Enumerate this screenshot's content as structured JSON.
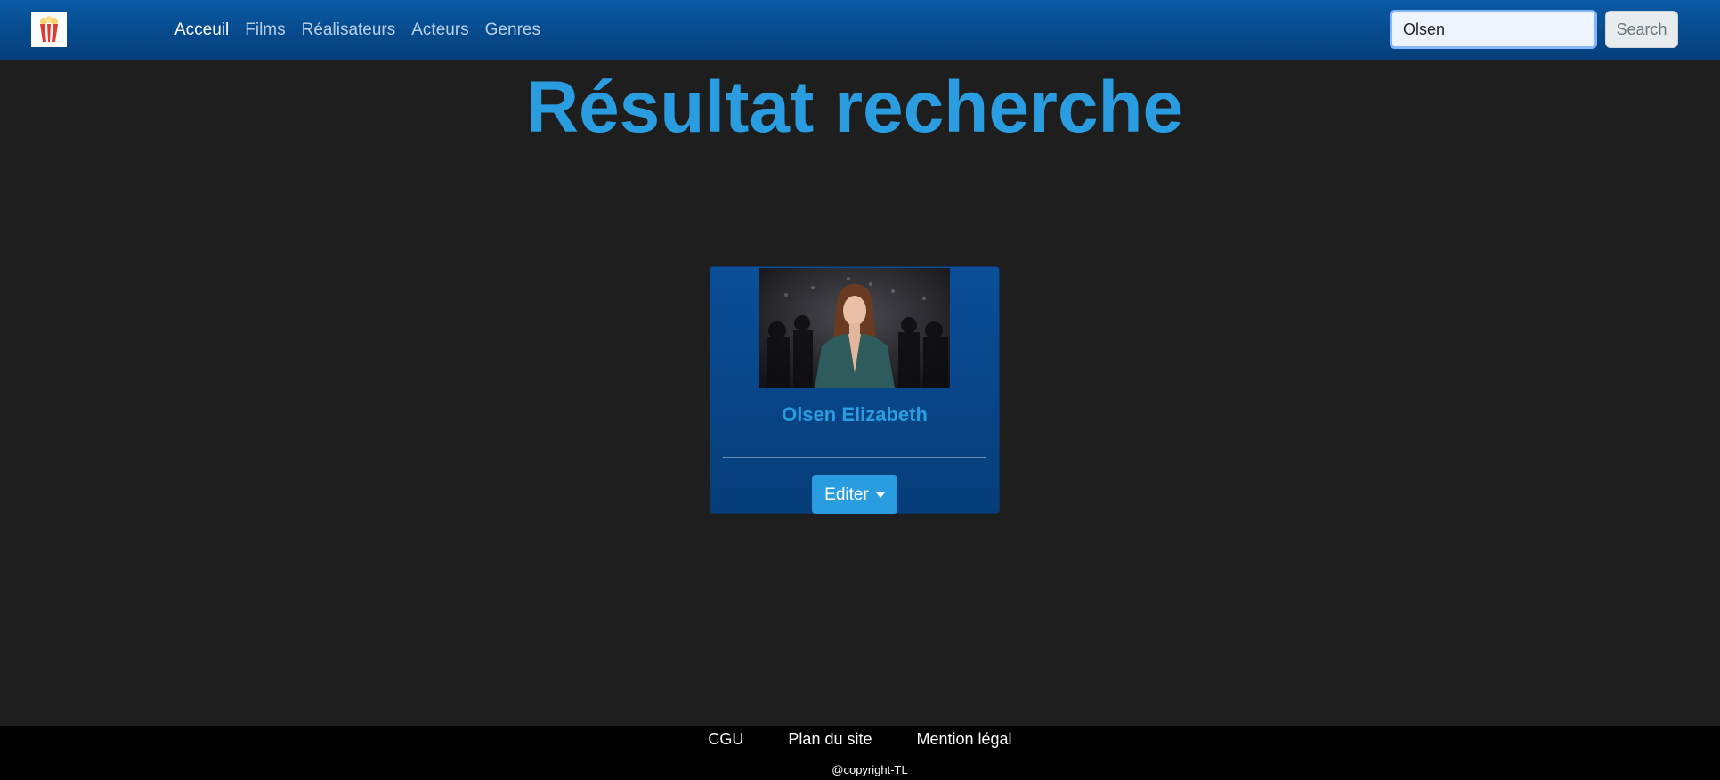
{
  "navbar": {
    "logo_icon": "popcorn-icon",
    "links": [
      {
        "label": "Acceuil",
        "active": true
      },
      {
        "label": "Films",
        "active": false
      },
      {
        "label": "Réalisateurs",
        "active": false
      },
      {
        "label": "Acteurs",
        "active": false
      },
      {
        "label": "Genres",
        "active": false
      }
    ],
    "search": {
      "value": "Olsen",
      "placeholder": "",
      "button_label": "Search"
    }
  },
  "main": {
    "title": "Résultat recherche",
    "results": [
      {
        "name": "Olsen Elizabeth",
        "edit_label": "Editer"
      }
    ]
  },
  "footer": {
    "links": [
      "CGU",
      "Plan du site",
      "Mention légal"
    ],
    "copyright": "@copyright-TL"
  },
  "colors": {
    "navbar": "#064a8c",
    "accent": "#2a9de0",
    "background": "#1e1e1e",
    "footer": "#000000"
  }
}
